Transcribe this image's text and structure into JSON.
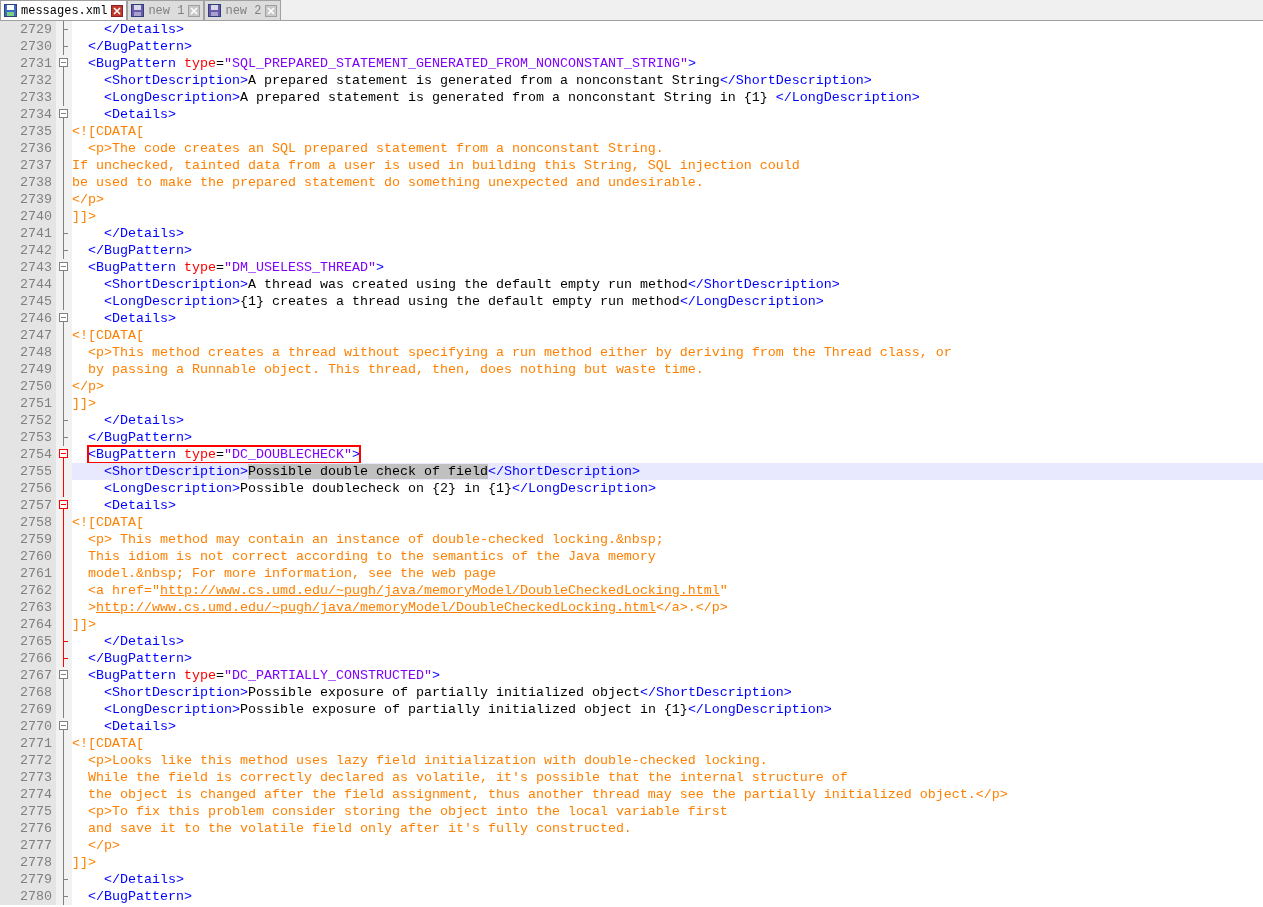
{
  "tabs": [
    {
      "label": "messages.xml",
      "selected": true
    },
    {
      "label": "new 1",
      "selected": false
    },
    {
      "label": "new 2",
      "selected": false
    }
  ],
  "lines": [
    {
      "number": "2729",
      "fold_open": false,
      "fold_end": true,
      "active": false,
      "current": false,
      "boxed": false,
      "segments": [
        {
          "kind": "tag",
          "text": "    </Details>"
        }
      ]
    },
    {
      "number": "2730",
      "fold_open": false,
      "fold_end": true,
      "active": false,
      "current": false,
      "boxed": false,
      "segments": [
        {
          "kind": "tag",
          "text": "  </BugPattern>"
        }
      ]
    },
    {
      "number": "2731",
      "fold_open": true,
      "fold_end": false,
      "active": false,
      "current": false,
      "boxed": false,
      "segments": [
        {
          "kind": "tag",
          "text": "  <BugPattern "
        },
        {
          "kind": "attr",
          "text": "type"
        },
        {
          "kind": "text",
          "text": "="
        },
        {
          "kind": "value",
          "text": "\"SQL_PREPARED_STATEMENT_GENERATED_FROM_NONCONSTANT_STRING\""
        },
        {
          "kind": "tag",
          "text": ">"
        }
      ]
    },
    {
      "number": "2732",
      "fold_open": false,
      "fold_end": false,
      "active": false,
      "current": false,
      "boxed": false,
      "segments": [
        {
          "kind": "tag",
          "text": "    <ShortDescription>"
        },
        {
          "kind": "text",
          "text": "A prepared statement is generated from a nonconstant String"
        },
        {
          "kind": "tag",
          "text": "</ShortDescription>"
        }
      ]
    },
    {
      "number": "2733",
      "fold_open": false,
      "fold_end": false,
      "active": false,
      "current": false,
      "boxed": false,
      "segments": [
        {
          "kind": "tag",
          "text": "    <LongDescription>"
        },
        {
          "kind": "text",
          "text": "A prepared statement is generated from a nonconstant String in {1} "
        },
        {
          "kind": "tag",
          "text": "</LongDescription>"
        }
      ]
    },
    {
      "number": "2734",
      "fold_open": true,
      "fold_end": false,
      "active": false,
      "current": false,
      "boxed": false,
      "segments": [
        {
          "kind": "tag",
          "text": "    <Details>"
        }
      ]
    },
    {
      "number": "2735",
      "fold_open": false,
      "fold_end": false,
      "active": false,
      "current": false,
      "boxed": false,
      "segments": [
        {
          "kind": "cdata",
          "text": "<![CDATA["
        }
      ]
    },
    {
      "number": "2736",
      "fold_open": false,
      "fold_end": false,
      "active": false,
      "current": false,
      "boxed": false,
      "segments": [
        {
          "kind": "cdata",
          "text": "  <p>The code creates an SQL prepared statement from a nonconstant String."
        }
      ]
    },
    {
      "number": "2737",
      "fold_open": false,
      "fold_end": false,
      "active": false,
      "current": false,
      "boxed": false,
      "segments": [
        {
          "kind": "cdata",
          "text": "If unchecked, tainted data from a user is used in building this String, SQL injection could"
        }
      ]
    },
    {
      "number": "2738",
      "fold_open": false,
      "fold_end": false,
      "active": false,
      "current": false,
      "boxed": false,
      "segments": [
        {
          "kind": "cdata",
          "text": "be used to make the prepared statement do something unexpected and undesirable."
        }
      ]
    },
    {
      "number": "2739",
      "fold_open": false,
      "fold_end": false,
      "active": false,
      "current": false,
      "boxed": false,
      "segments": [
        {
          "kind": "cdata",
          "text": "</p>"
        }
      ]
    },
    {
      "number": "2740",
      "fold_open": false,
      "fold_end": false,
      "active": false,
      "current": false,
      "boxed": false,
      "segments": [
        {
          "kind": "cdata",
          "text": "]]>"
        }
      ]
    },
    {
      "number": "2741",
      "fold_open": false,
      "fold_end": true,
      "active": false,
      "current": false,
      "boxed": false,
      "segments": [
        {
          "kind": "tag",
          "text": "    </Details>"
        }
      ]
    },
    {
      "number": "2742",
      "fold_open": false,
      "fold_end": true,
      "active": false,
      "current": false,
      "boxed": false,
      "segments": [
        {
          "kind": "tag",
          "text": "  </BugPattern>"
        }
      ]
    },
    {
      "number": "2743",
      "fold_open": true,
      "fold_end": false,
      "active": false,
      "current": false,
      "boxed": false,
      "segments": [
        {
          "kind": "tag",
          "text": "  <BugPattern "
        },
        {
          "kind": "attr",
          "text": "type"
        },
        {
          "kind": "text",
          "text": "="
        },
        {
          "kind": "value",
          "text": "\"DM_USELESS_THREAD\""
        },
        {
          "kind": "tag",
          "text": ">"
        }
      ]
    },
    {
      "number": "2744",
      "fold_open": false,
      "fold_end": false,
      "active": false,
      "current": false,
      "boxed": false,
      "segments": [
        {
          "kind": "tag",
          "text": "    <ShortDescription>"
        },
        {
          "kind": "text",
          "text": "A thread was created using the default empty run method"
        },
        {
          "kind": "tag",
          "text": "</ShortDescription>"
        }
      ]
    },
    {
      "number": "2745",
      "fold_open": false,
      "fold_end": false,
      "active": false,
      "current": false,
      "boxed": false,
      "segments": [
        {
          "kind": "tag",
          "text": "    <LongDescription>"
        },
        {
          "kind": "text",
          "text": "{1} creates a thread using the default empty run method"
        },
        {
          "kind": "tag",
          "text": "</LongDescription>"
        }
      ]
    },
    {
      "number": "2746",
      "fold_open": true,
      "fold_end": false,
      "active": false,
      "current": false,
      "boxed": false,
      "segments": [
        {
          "kind": "tag",
          "text": "    <Details>"
        }
      ]
    },
    {
      "number": "2747",
      "fold_open": false,
      "fold_end": false,
      "active": false,
      "current": false,
      "boxed": false,
      "segments": [
        {
          "kind": "cdata",
          "text": "<![CDATA["
        }
      ]
    },
    {
      "number": "2748",
      "fold_open": false,
      "fold_end": false,
      "active": false,
      "current": false,
      "boxed": false,
      "segments": [
        {
          "kind": "cdata",
          "text": "  <p>This method creates a thread without specifying a run method either by deriving from the Thread class, or"
        }
      ]
    },
    {
      "number": "2749",
      "fold_open": false,
      "fold_end": false,
      "active": false,
      "current": false,
      "boxed": false,
      "segments": [
        {
          "kind": "cdata",
          "text": "  by passing a Runnable object. This thread, then, does nothing but waste time."
        }
      ]
    },
    {
      "number": "2750",
      "fold_open": false,
      "fold_end": false,
      "active": false,
      "current": false,
      "boxed": false,
      "segments": [
        {
          "kind": "cdata",
          "text": "</p>"
        }
      ]
    },
    {
      "number": "2751",
      "fold_open": false,
      "fold_end": false,
      "active": false,
      "current": false,
      "boxed": false,
      "segments": [
        {
          "kind": "cdata",
          "text": "]]>"
        }
      ]
    },
    {
      "number": "2752",
      "fold_open": false,
      "fold_end": true,
      "active": false,
      "current": false,
      "boxed": false,
      "segments": [
        {
          "kind": "tag",
          "text": "    </Details>"
        }
      ]
    },
    {
      "number": "2753",
      "fold_open": false,
      "fold_end": true,
      "active": false,
      "current": false,
      "boxed": false,
      "segments": [
        {
          "kind": "tag",
          "text": "  </BugPattern>"
        }
      ]
    },
    {
      "number": "2754",
      "fold_open": true,
      "fold_end": false,
      "active": true,
      "current": false,
      "boxed": true,
      "segments": [
        {
          "kind": "tag",
          "text": "  <BugPattern "
        },
        {
          "kind": "attr",
          "text": "type"
        },
        {
          "kind": "text",
          "text": "="
        },
        {
          "kind": "value",
          "text": "\"DC_DOUBLECHECK\""
        },
        {
          "kind": "tag",
          "text": ">"
        }
      ]
    },
    {
      "number": "2755",
      "fold_open": false,
      "fold_end": false,
      "active": true,
      "current": true,
      "boxed": false,
      "segments": [
        {
          "kind": "tag",
          "text": "    <ShortDescription>"
        },
        {
          "kind": "selected",
          "text": "Possible double check of field"
        },
        {
          "kind": "tag",
          "text": "</ShortDescription>"
        }
      ]
    },
    {
      "number": "2756",
      "fold_open": false,
      "fold_end": false,
      "active": true,
      "current": false,
      "boxed": false,
      "segments": [
        {
          "kind": "tag",
          "text": "    <LongDescription>"
        },
        {
          "kind": "text",
          "text": "Possible doublecheck on {2} in {1}"
        },
        {
          "kind": "tag",
          "text": "</LongDescription>"
        }
      ]
    },
    {
      "number": "2757",
      "fold_open": true,
      "fold_end": false,
      "active": true,
      "current": false,
      "boxed": false,
      "segments": [
        {
          "kind": "tag",
          "text": "    <Details>"
        }
      ]
    },
    {
      "number": "2758",
      "fold_open": false,
      "fold_end": false,
      "active": true,
      "current": false,
      "boxed": false,
      "segments": [
        {
          "kind": "cdata",
          "text": "<![CDATA["
        }
      ]
    },
    {
      "number": "2759",
      "fold_open": false,
      "fold_end": false,
      "active": true,
      "current": false,
      "boxed": false,
      "segments": [
        {
          "kind": "cdata",
          "text": "  <p> This method may contain an instance of double-checked locking.&nbsp;"
        }
      ]
    },
    {
      "number": "2760",
      "fold_open": false,
      "fold_end": false,
      "active": true,
      "current": false,
      "boxed": false,
      "segments": [
        {
          "kind": "cdata",
          "text": "  This idiom is not correct according to the semantics of the Java memory"
        }
      ]
    },
    {
      "number": "2761",
      "fold_open": false,
      "fold_end": false,
      "active": true,
      "current": false,
      "boxed": false,
      "segments": [
        {
          "kind": "cdata",
          "text": "  model.&nbsp; For more information, see the web page"
        }
      ]
    },
    {
      "number": "2762",
      "fold_open": false,
      "fold_end": false,
      "active": true,
      "current": false,
      "boxed": false,
      "segments": [
        {
          "kind": "cdata",
          "text": "  <a href=\""
        },
        {
          "kind": "link",
          "text": "http://www.cs.umd.edu/~pugh/java/memoryModel/DoubleCheckedLocking.html"
        },
        {
          "kind": "cdata",
          "text": "\""
        }
      ]
    },
    {
      "number": "2763",
      "fold_open": false,
      "fold_end": false,
      "active": true,
      "current": false,
      "boxed": false,
      "segments": [
        {
          "kind": "cdata",
          "text": "  >"
        },
        {
          "kind": "link",
          "text": "http://www.cs.umd.edu/~pugh/java/memoryModel/DoubleCheckedLocking.html"
        },
        {
          "kind": "cdata",
          "text": "</a>.</p>"
        }
      ]
    },
    {
      "number": "2764",
      "fold_open": false,
      "fold_end": false,
      "active": true,
      "current": false,
      "boxed": false,
      "segments": [
        {
          "kind": "cdata",
          "text": "]]>"
        }
      ]
    },
    {
      "number": "2765",
      "fold_open": false,
      "fold_end": true,
      "active": true,
      "current": false,
      "boxed": false,
      "segments": [
        {
          "kind": "tag",
          "text": "    </Details>"
        }
      ]
    },
    {
      "number": "2766",
      "fold_open": false,
      "fold_end": true,
      "active": true,
      "current": false,
      "boxed": false,
      "segments": [
        {
          "kind": "tag",
          "text": "  </BugPattern>"
        }
      ]
    },
    {
      "number": "2767",
      "fold_open": true,
      "fold_end": false,
      "active": false,
      "current": false,
      "boxed": false,
      "segments": [
        {
          "kind": "tag",
          "text": "  <BugPattern "
        },
        {
          "kind": "attr",
          "text": "type"
        },
        {
          "kind": "text",
          "text": "="
        },
        {
          "kind": "value",
          "text": "\"DC_PARTIALLY_CONSTRUCTED\""
        },
        {
          "kind": "tag",
          "text": ">"
        }
      ]
    },
    {
      "number": "2768",
      "fold_open": false,
      "fold_end": false,
      "active": false,
      "current": false,
      "boxed": false,
      "segments": [
        {
          "kind": "tag",
          "text": "    <ShortDescription>"
        },
        {
          "kind": "text",
          "text": "Possible exposure of partially initialized object"
        },
        {
          "kind": "tag",
          "text": "</ShortDescription>"
        }
      ]
    },
    {
      "number": "2769",
      "fold_open": false,
      "fold_end": false,
      "active": false,
      "current": false,
      "boxed": false,
      "segments": [
        {
          "kind": "tag",
          "text": "    <LongDescription>"
        },
        {
          "kind": "text",
          "text": "Possible exposure of partially initialized object in {1}"
        },
        {
          "kind": "tag",
          "text": "</LongDescription>"
        }
      ]
    },
    {
      "number": "2770",
      "fold_open": true,
      "fold_end": false,
      "active": false,
      "current": false,
      "boxed": false,
      "segments": [
        {
          "kind": "tag",
          "text": "    <Details>"
        }
      ]
    },
    {
      "number": "2771",
      "fold_open": false,
      "fold_end": false,
      "active": false,
      "current": false,
      "boxed": false,
      "segments": [
        {
          "kind": "cdata",
          "text": "<![CDATA["
        }
      ]
    },
    {
      "number": "2772",
      "fold_open": false,
      "fold_end": false,
      "active": false,
      "current": false,
      "boxed": false,
      "segments": [
        {
          "kind": "cdata",
          "text": "  <p>Looks like this method uses lazy field initialization with double-checked locking."
        }
      ]
    },
    {
      "number": "2773",
      "fold_open": false,
      "fold_end": false,
      "active": false,
      "current": false,
      "boxed": false,
      "segments": [
        {
          "kind": "cdata",
          "text": "  While the field is correctly declared as volatile, it's possible that the internal structure of"
        }
      ]
    },
    {
      "number": "2774",
      "fold_open": false,
      "fold_end": false,
      "active": false,
      "current": false,
      "boxed": false,
      "segments": [
        {
          "kind": "cdata",
          "text": "  the object is changed after the field assignment, thus another thread may see the partially initialized object.</p>"
        }
      ]
    },
    {
      "number": "2775",
      "fold_open": false,
      "fold_end": false,
      "active": false,
      "current": false,
      "boxed": false,
      "segments": [
        {
          "kind": "cdata",
          "text": "  <p>To fix this problem consider storing the object into the local variable first"
        }
      ]
    },
    {
      "number": "2776",
      "fold_open": false,
      "fold_end": false,
      "active": false,
      "current": false,
      "boxed": false,
      "segments": [
        {
          "kind": "cdata",
          "text": "  and save it to the volatile field only after it's fully constructed."
        }
      ]
    },
    {
      "number": "2777",
      "fold_open": false,
      "fold_end": false,
      "active": false,
      "current": false,
      "boxed": false,
      "segments": [
        {
          "kind": "cdata",
          "text": "  </p>"
        }
      ]
    },
    {
      "number": "2778",
      "fold_open": false,
      "fold_end": false,
      "active": false,
      "current": false,
      "boxed": false,
      "segments": [
        {
          "kind": "cdata",
          "text": "]]>"
        }
      ]
    },
    {
      "number": "2779",
      "fold_open": false,
      "fold_end": true,
      "active": false,
      "current": false,
      "boxed": false,
      "segments": [
        {
          "kind": "tag",
          "text": "    </Details>"
        }
      ]
    },
    {
      "number": "2780",
      "fold_open": false,
      "fold_end": true,
      "active": false,
      "current": false,
      "boxed": false,
      "segments": [
        {
          "kind": "tag",
          "text": "  </BugPattern>"
        }
      ]
    }
  ]
}
